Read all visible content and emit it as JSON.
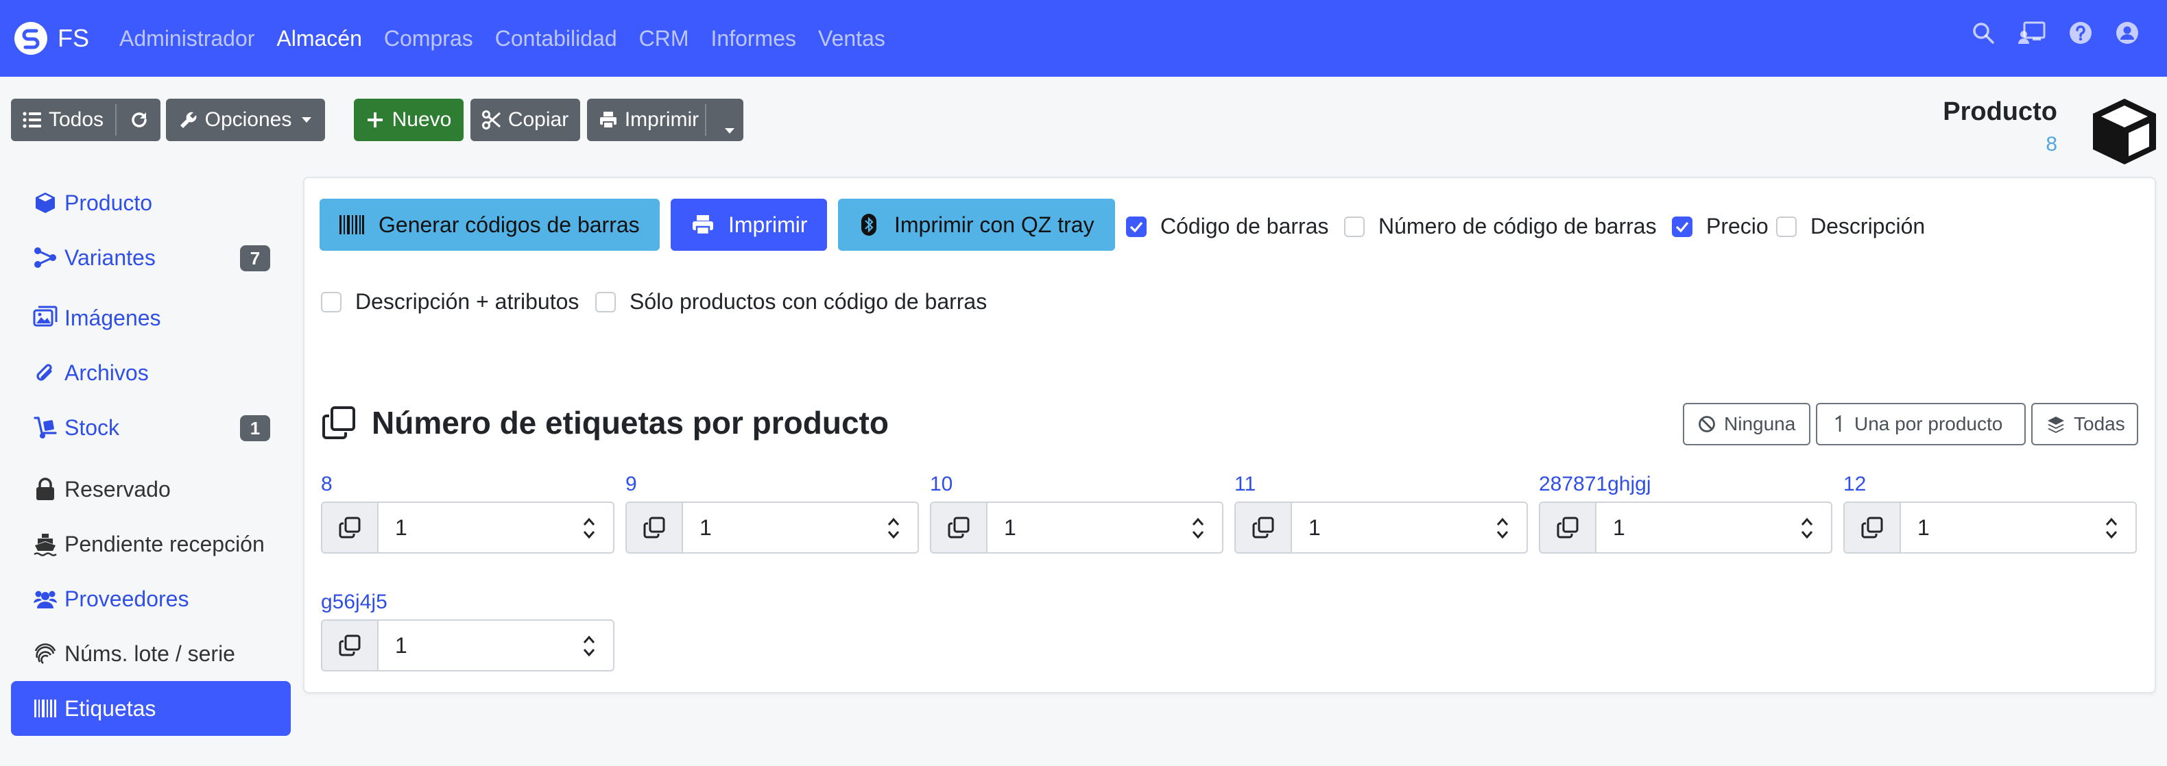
{
  "navbar": {
    "brand": "FS",
    "menu": [
      {
        "label": "Administrador",
        "active": false
      },
      {
        "label": "Almacén",
        "active": true
      },
      {
        "label": "Compras",
        "active": false
      },
      {
        "label": "Contabilidad",
        "active": false
      },
      {
        "label": "CRM",
        "active": false
      },
      {
        "label": "Informes",
        "active": false
      },
      {
        "label": "Ventas",
        "active": false
      }
    ],
    "icons": [
      "search-icon",
      "chalkboard-user-icon",
      "help-icon",
      "user-icon"
    ]
  },
  "toolbar": {
    "all_label": "Todos",
    "options_label": "Opciones",
    "new_label": "Nuevo",
    "copy_label": "Copiar",
    "print_label": "Imprimir"
  },
  "header": {
    "title": "Producto",
    "count": "8"
  },
  "sidebar": {
    "items": [
      {
        "label": "Producto",
        "icon": "cube-icon"
      },
      {
        "label": "Variantes",
        "icon": "sitemap-icon",
        "badge": "7"
      },
      {
        "label": "Imágenes",
        "icon": "images-icon"
      },
      {
        "label": "Archivos",
        "icon": "paperclip-icon"
      },
      {
        "label": "Stock",
        "icon": "dolly-icon",
        "badge": "1"
      },
      {
        "label": "Reservado",
        "icon": "lock-icon"
      },
      {
        "label": "Pendiente recepción",
        "icon": "ship-icon"
      },
      {
        "label": "Proveedores",
        "icon": "users-icon"
      },
      {
        "label": "Núms. lote / serie",
        "icon": "fingerprint-icon"
      },
      {
        "label": "Etiquetas",
        "icon": "barcode-icon",
        "active": true
      }
    ]
  },
  "actions": {
    "generate_label": "Generar códigos de barras",
    "print_label": "Imprimir",
    "qz_label": "Imprimir con QZ tray"
  },
  "options": [
    {
      "label": "Código de barras",
      "checked": true
    },
    {
      "label": "Número de código de barras",
      "checked": false
    },
    {
      "label": "Precio",
      "checked": true
    },
    {
      "label": "Descripción",
      "checked": false
    },
    {
      "label": "Descripción + atributos",
      "checked": false
    },
    {
      "label": "Sólo productos con código de barras",
      "checked": false
    }
  ],
  "labels_section": {
    "title": "Número de etiquetas por producto",
    "none_label": "Ninguna",
    "one_label": "Una por producto",
    "all_label": "Todas",
    "fields": [
      {
        "ref": "8",
        "value": "1"
      },
      {
        "ref": "9",
        "value": "1"
      },
      {
        "ref": "10",
        "value": "1"
      },
      {
        "ref": "11",
        "value": "1"
      },
      {
        "ref": "287871ghjgj",
        "value": "1"
      },
      {
        "ref": "12",
        "value": "1"
      },
      {
        "ref": "g56j4j5",
        "value": "1"
      }
    ]
  },
  "colors": {
    "navbar": "#3d5afe",
    "primary": "#3d5afe",
    "info": "#54b3e6",
    "success": "#2e7d32",
    "secondary": "#5b6269",
    "link": "#2f4fe6"
  }
}
